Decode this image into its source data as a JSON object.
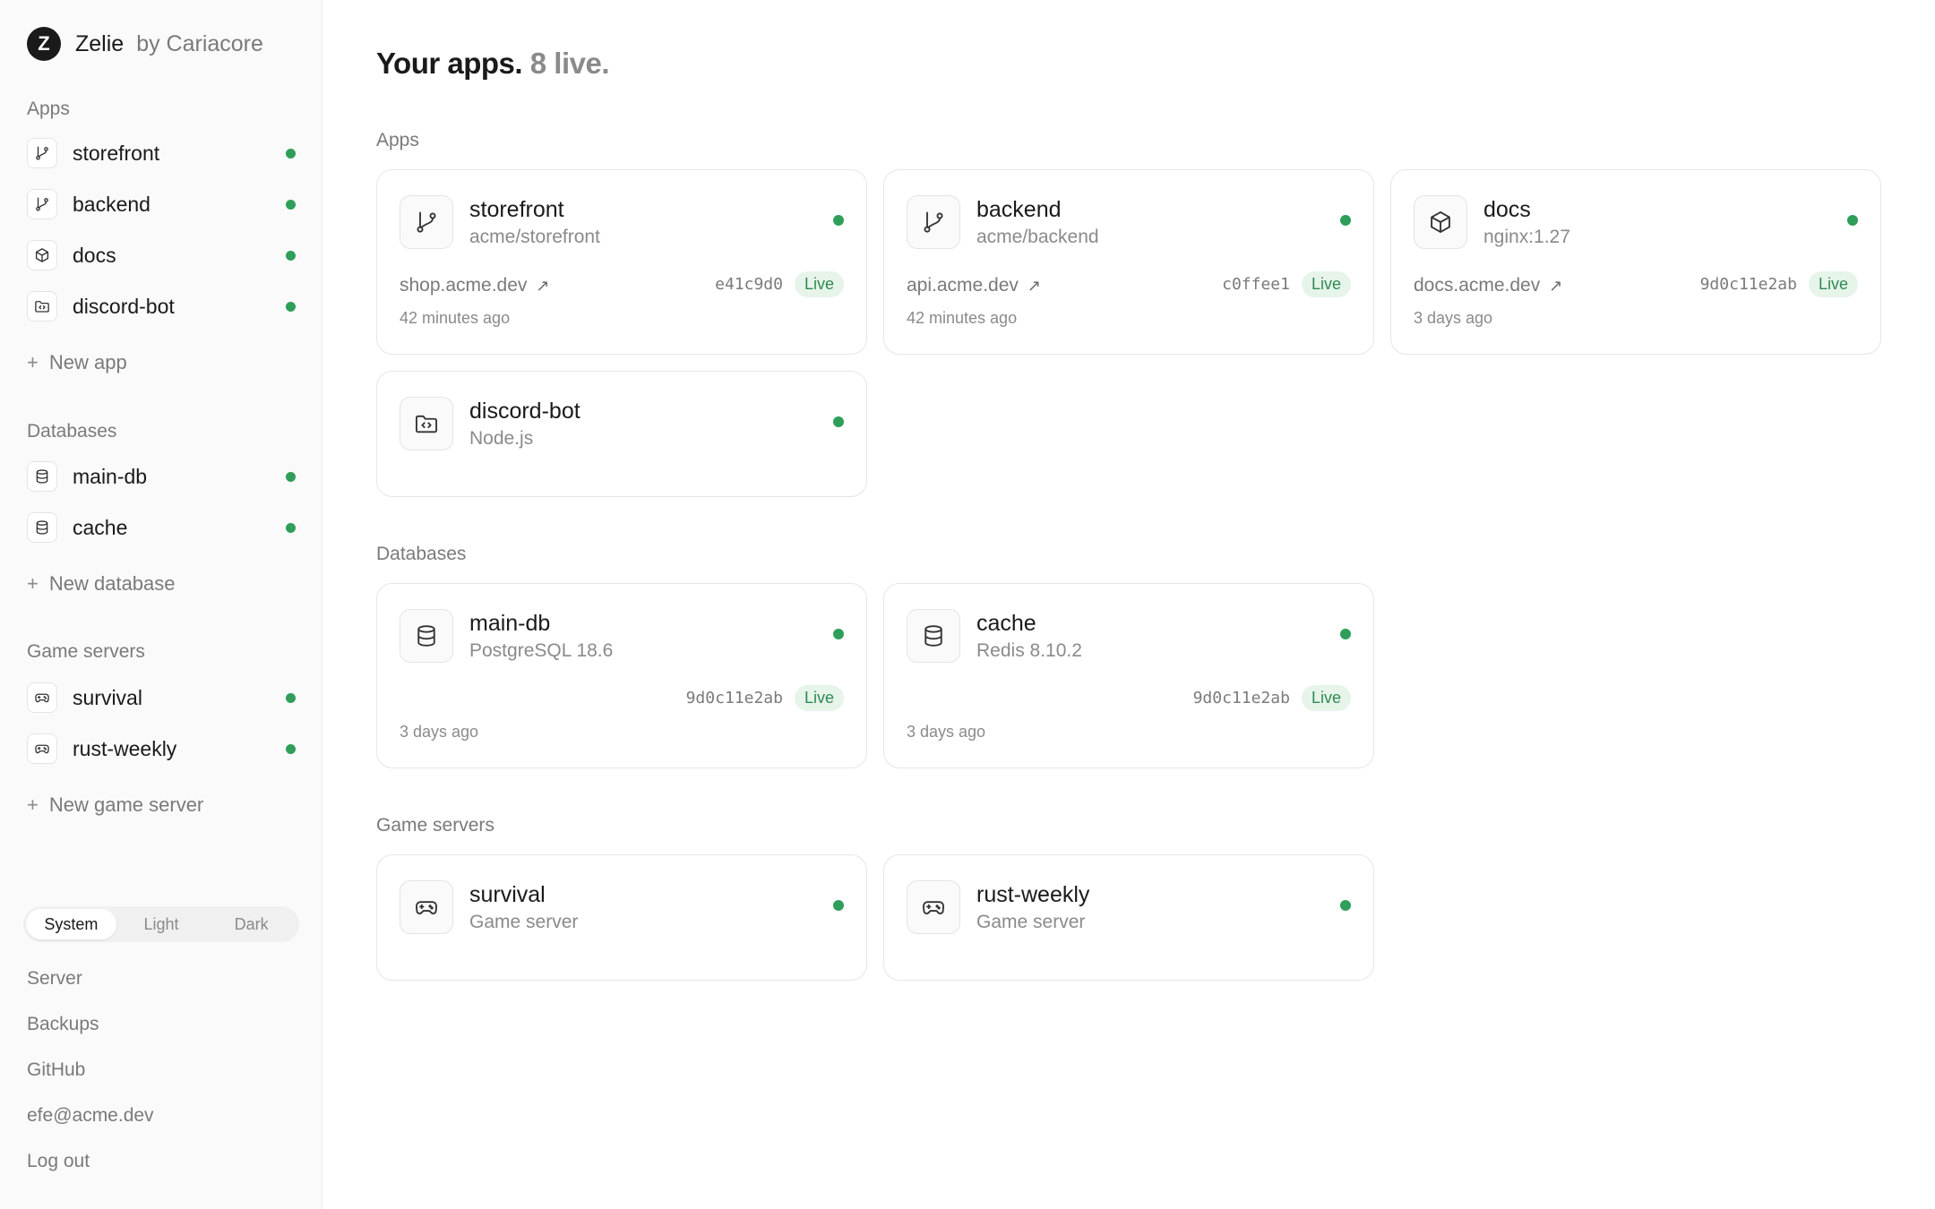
{
  "brand": {
    "logo": "Z",
    "name": "Zelie",
    "by": "by Cariacore"
  },
  "sidebar": {
    "apps_title": "Apps",
    "apps": [
      {
        "label": "storefront",
        "icon": "git-branch-icon"
      },
      {
        "label": "backend",
        "icon": "git-branch-icon"
      },
      {
        "label": "docs",
        "icon": "cube-icon"
      },
      {
        "label": "discord-bot",
        "icon": "folder-code-icon"
      }
    ],
    "new_app": "New app",
    "databases_title": "Databases",
    "databases": [
      {
        "label": "main-db",
        "icon": "database-icon"
      },
      {
        "label": "cache",
        "icon": "database-icon"
      }
    ],
    "new_database": "New database",
    "game_servers_title": "Game servers",
    "game_servers": [
      {
        "label": "survival",
        "icon": "gamepad-icon"
      },
      {
        "label": "rust-weekly",
        "icon": "gamepad-icon"
      }
    ],
    "new_game_server": "New game server",
    "plus": "+",
    "theme": {
      "options": [
        "System",
        "Light",
        "Dark"
      ],
      "selected": "System"
    },
    "footer": [
      "Server",
      "Backups",
      "GitHub",
      "efe@acme.dev",
      "Log out"
    ]
  },
  "main": {
    "title": "Your apps.",
    "title_count": "8 live.",
    "sections": {
      "apps": "Apps",
      "databases": "Databases",
      "game_servers": "Game servers"
    },
    "cards": {
      "storefront": {
        "name": "storefront",
        "sub": "acme/storefront",
        "domain": "shop.acme.dev",
        "commit": "e41c9d0",
        "status": "Live",
        "time": "42 minutes ago"
      },
      "backend": {
        "name": "backend",
        "sub": "acme/backend",
        "domain": "api.acme.dev",
        "commit": "c0ffee1",
        "status": "Live",
        "time": "42 minutes ago"
      },
      "docs": {
        "name": "docs",
        "sub": "nginx:1.27",
        "domain": "docs.acme.dev",
        "commit": "9d0c11e2ab",
        "status": "Live",
        "time": "3 days ago"
      },
      "discord_bot": {
        "name": "discord-bot",
        "sub": "Node.js"
      },
      "main_db": {
        "name": "main-db",
        "sub": "PostgreSQL 18.6",
        "commit": "9d0c11e2ab",
        "status": "Live",
        "time": "3 days ago"
      },
      "cache": {
        "name": "cache",
        "sub": "Redis 8.10.2",
        "commit": "9d0c11e2ab",
        "status": "Live",
        "time": "3 days ago"
      },
      "survival": {
        "name": "survival",
        "sub": "Game server"
      },
      "rust_weekly": {
        "name": "rust-weekly",
        "sub": "Game server"
      }
    },
    "external_arrow": "↗"
  },
  "colors": {
    "live": "#2f9e5b",
    "live_badge_bg": "#e6f4ea",
    "live_badge_text": "#2f8a52"
  }
}
